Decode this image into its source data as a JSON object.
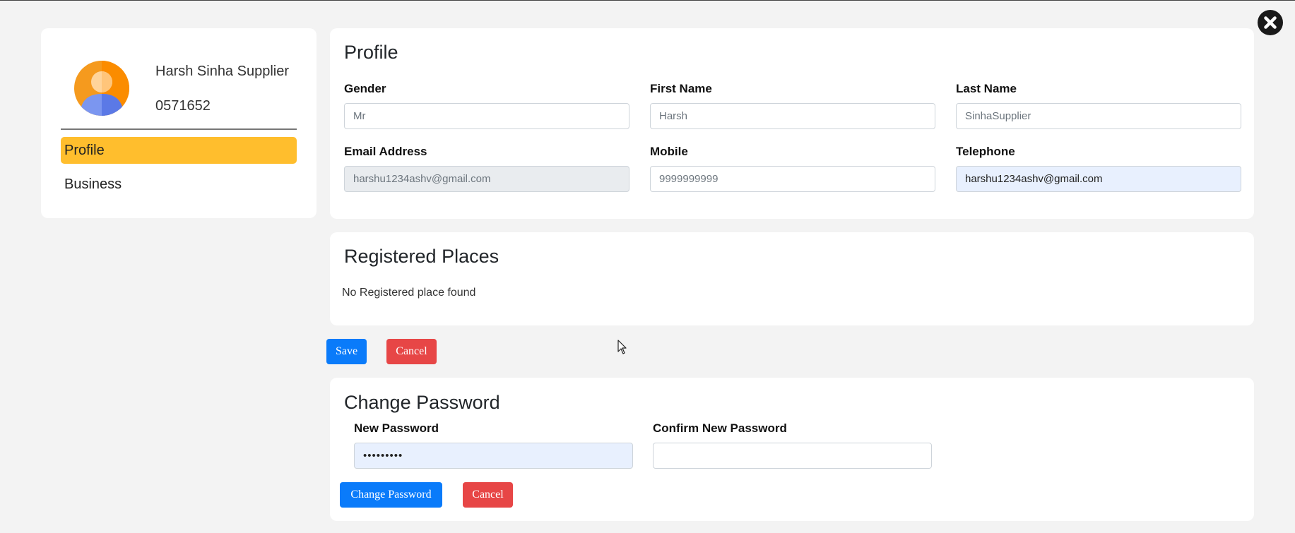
{
  "sidebar": {
    "user_name": "Harsh Sinha Supplier",
    "user_id": "0571652",
    "items": [
      {
        "label": "Profile",
        "active": true
      },
      {
        "label": "Business",
        "active": false
      }
    ]
  },
  "profile": {
    "title": "Profile",
    "fields": {
      "gender": {
        "label": "Gender",
        "value": "Mr"
      },
      "first_name": {
        "label": "First Name",
        "value": "Harsh"
      },
      "last_name": {
        "label": "Last Name",
        "value": "SinhaSupplier"
      },
      "email": {
        "label": "Email Address",
        "value": "harshu1234ashv@gmail.com"
      },
      "mobile": {
        "label": "Mobile",
        "value": "9999999999"
      },
      "telephone": {
        "label": "Telephone",
        "value": "harshu1234ashv@gmail.com"
      }
    }
  },
  "registered_places": {
    "title": "Registered Places",
    "empty_message": "No Registered place found"
  },
  "actions": {
    "save_label": "Save",
    "cancel_label": "Cancel"
  },
  "change_password": {
    "title": "Change Password",
    "new_password_label": "New Password",
    "new_password_value": "•••••••••",
    "confirm_label": "Confirm New Password",
    "confirm_value": "",
    "submit_label": "Change Password",
    "cancel_label": "Cancel"
  },
  "colors": {
    "accent": "#ffbe2d",
    "primary": "#0a7bfa",
    "danger": "#e74646"
  }
}
